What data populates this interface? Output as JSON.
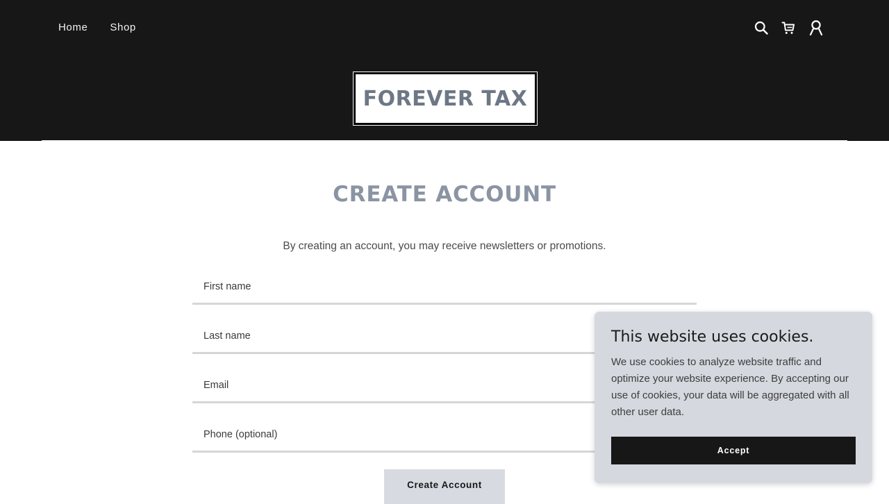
{
  "nav": {
    "home_label": "Home",
    "shop_label": "Shop"
  },
  "header_icons": [
    "search-icon",
    "cart-icon",
    "account-icon"
  ],
  "brand": {
    "logo_text": "FOREVER TAX"
  },
  "page": {
    "title": "CREATE ACCOUNT",
    "subtitle": "By creating an account, you may receive newsletters or promotions."
  },
  "form": {
    "first_name_label": "First name",
    "last_name_label": "Last name",
    "email_label": "Email",
    "phone_label": "Phone (optional)",
    "submit_label": "Create Account"
  },
  "cookie_banner": {
    "title": "This website uses cookies.",
    "body": "We use cookies to analyze website traffic and optimize your website experience. By accepting our use of cookies, your data will be aggregated with all other user data.",
    "accept_label": "Accept"
  },
  "colors": {
    "header_bg": "#171717",
    "title": "#8b94a3",
    "logo_text": "#6e7785",
    "button_bg": "#d7dbe1",
    "cookie_bg": "#d5d8de",
    "accept_bg": "#171717"
  }
}
